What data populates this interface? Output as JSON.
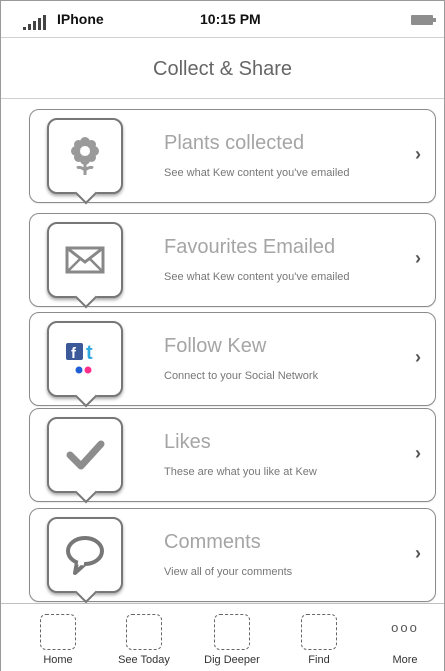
{
  "status_bar": {
    "carrier": "IPhone",
    "time": "10:15 PM",
    "icons": [
      "signal-icon",
      "battery-icon"
    ]
  },
  "header": {
    "title": "Collect & Share"
  },
  "menu": {
    "items": [
      {
        "label": "Plants collected",
        "subtitle": "See what Kew content you've emailed",
        "icon": "flower-icon",
        "chevron": "›"
      },
      {
        "label": "Favourites Emailed",
        "subtitle": "See what Kew content you've emailed",
        "icon": "envelope-icon",
        "chevron": "›"
      },
      {
        "label": "Follow Kew",
        "subtitle": "Connect to your Social Network",
        "icon": "social-network-icon",
        "chevron": "›"
      },
      {
        "label": "Likes",
        "subtitle": "These are what you like at Kew",
        "icon": "checkmark-icon",
        "chevron": "›"
      },
      {
        "label": "Comments",
        "subtitle": "View all of your comments",
        "icon": "speech-bubble-icon",
        "chevron": "›"
      }
    ]
  },
  "tab_bar": {
    "tabs": [
      {
        "label": "Home"
      },
      {
        "label": "See Today"
      },
      {
        "label": "Dig Deeper"
      },
      {
        "label": "Find"
      },
      {
        "label": "More",
        "icon_text": "ooo"
      }
    ]
  },
  "colors": {
    "border": "#8b8b8b",
    "label": "#a5a5a5",
    "facebook": "#3b5998",
    "twitter": "#2fa8e0",
    "flickr_blue": "#1f5fd6",
    "flickr_pink": "#ff2f8a"
  }
}
